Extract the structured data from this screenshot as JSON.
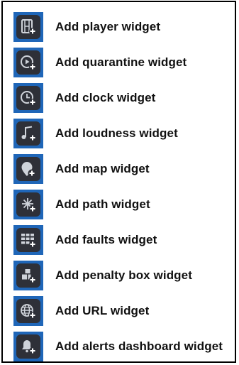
{
  "menu": {
    "items": [
      {
        "label": "Add player widget",
        "icon": "player-icon"
      },
      {
        "label": "Add quarantine widget",
        "icon": "quarantine-icon"
      },
      {
        "label": "Add clock widget",
        "icon": "clock-icon"
      },
      {
        "label": "Add loudness widget",
        "icon": "loudness-icon"
      },
      {
        "label": "Add map widget",
        "icon": "map-icon"
      },
      {
        "label": "Add path widget",
        "icon": "path-icon"
      },
      {
        "label": "Add faults widget",
        "icon": "faults-icon"
      },
      {
        "label": "Add penalty box widget",
        "icon": "penalty-box-icon"
      },
      {
        "label": "Add URL widget",
        "icon": "url-icon"
      },
      {
        "label": "Add alerts dashboard widget",
        "icon": "alerts-dashboard-icon"
      }
    ]
  }
}
